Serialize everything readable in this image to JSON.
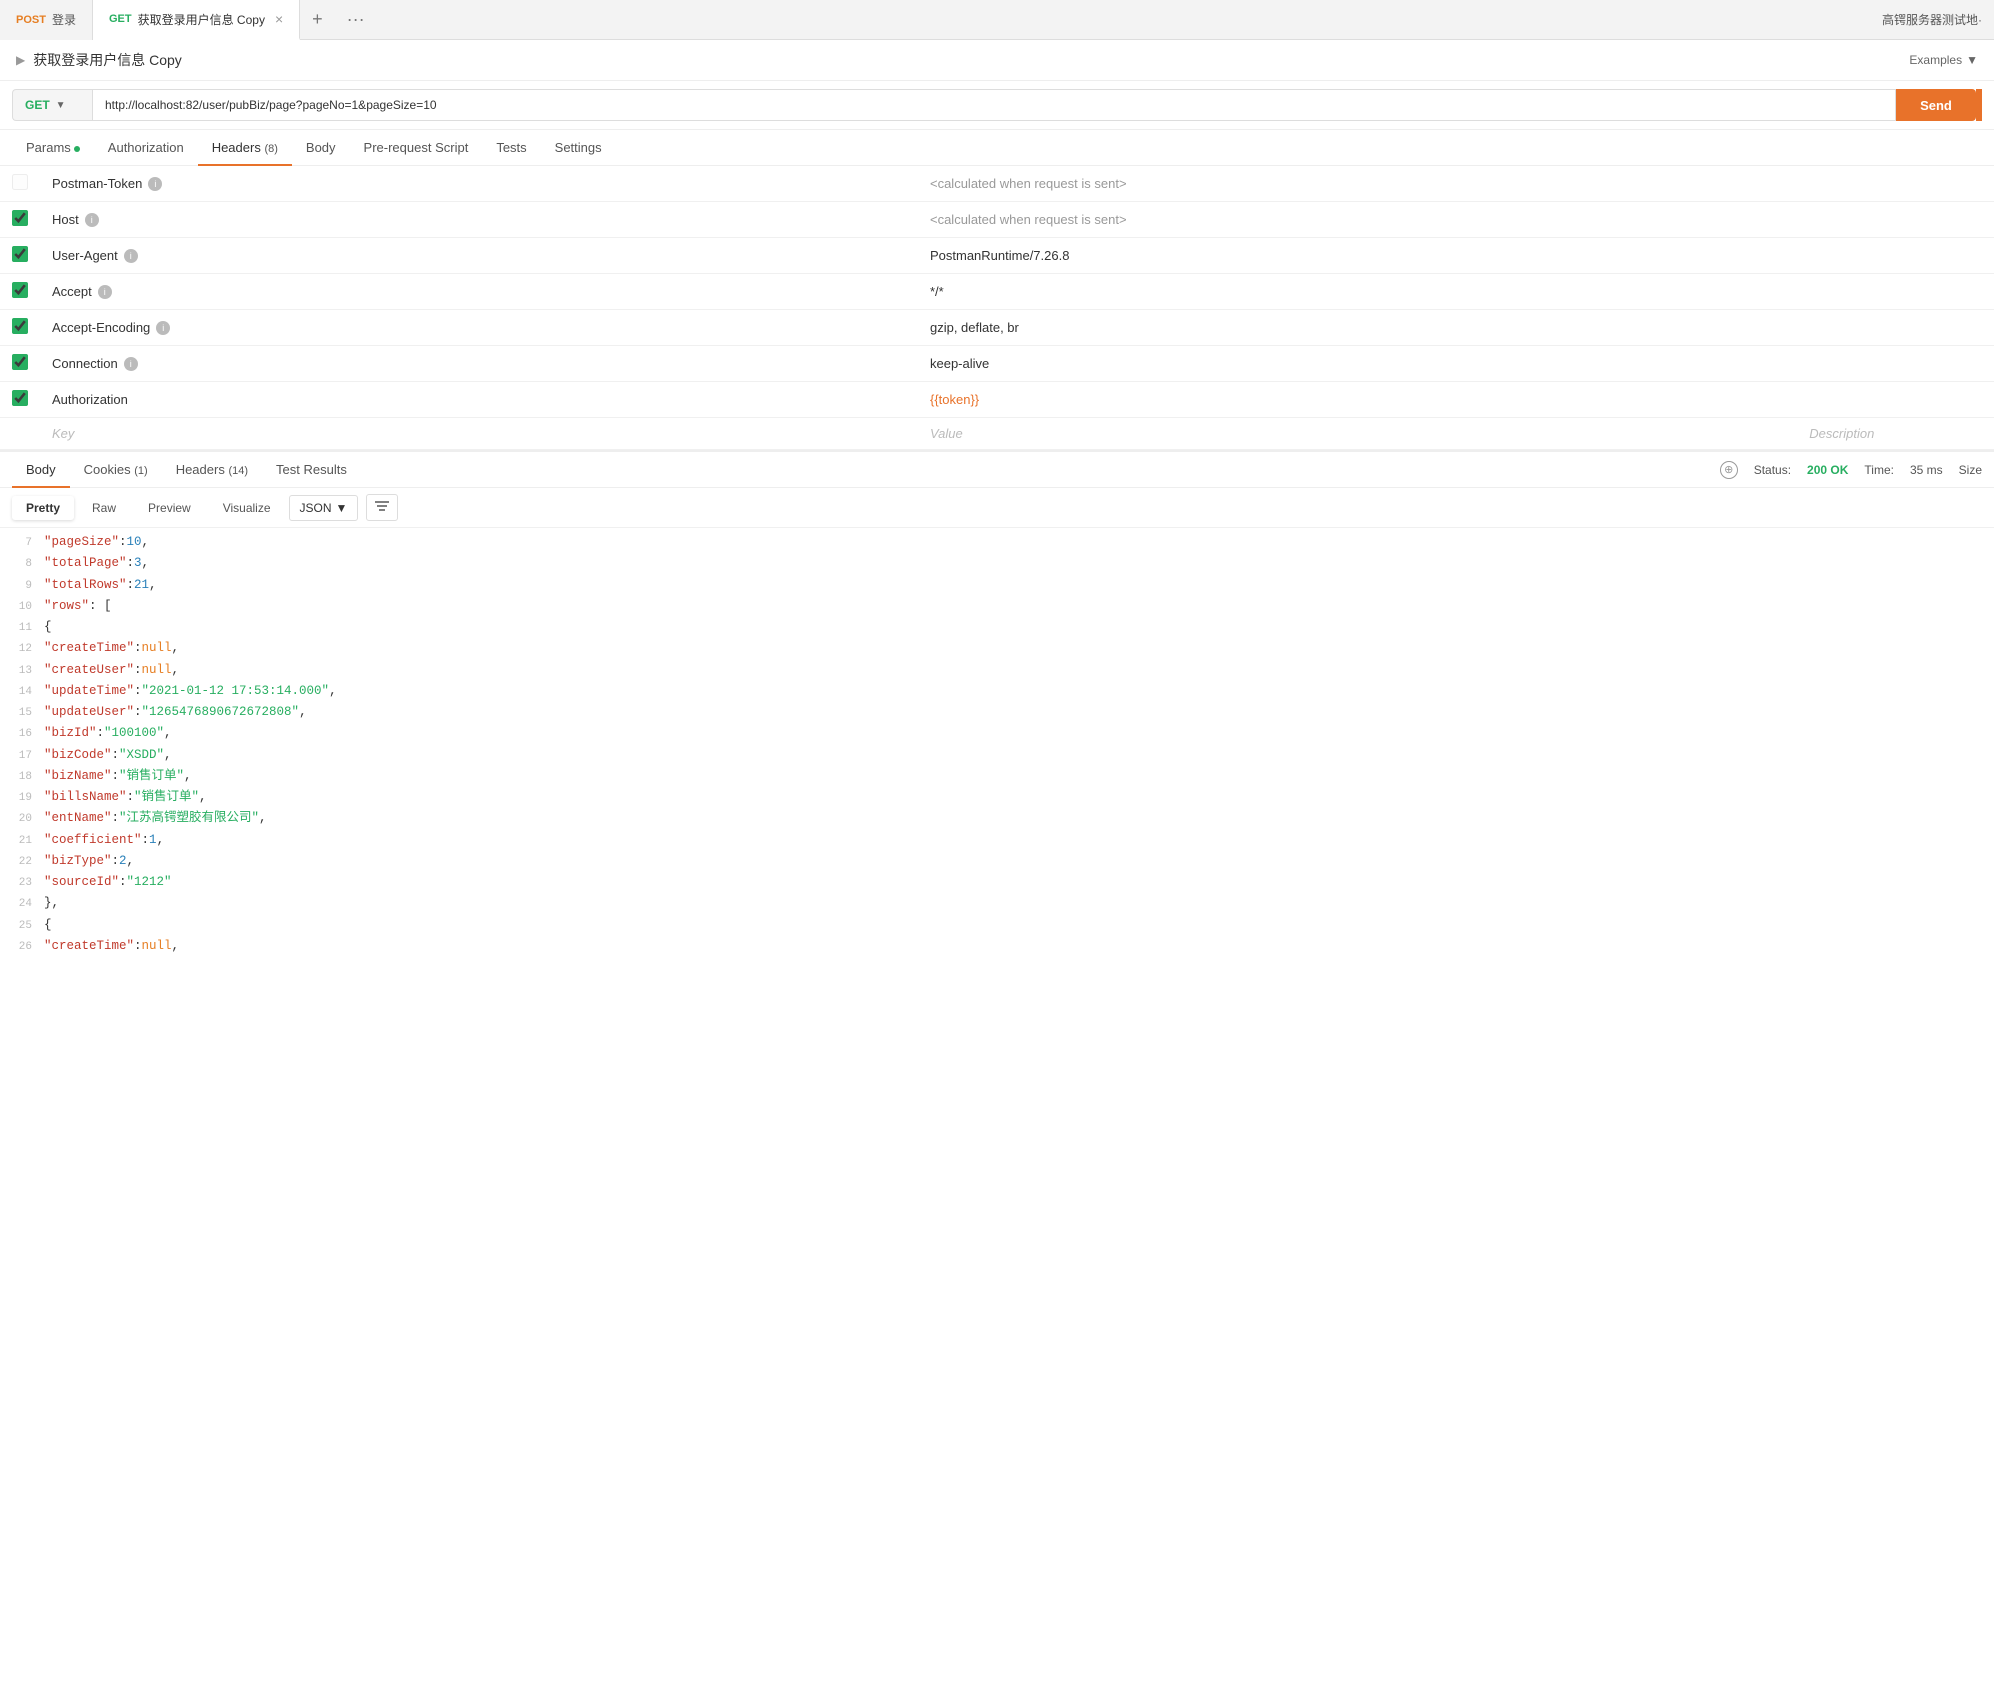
{
  "tabs": [
    {
      "id": "tab1",
      "method": "POST",
      "method_class": "post",
      "label": "登录",
      "active": false,
      "closeable": false
    },
    {
      "id": "tab2",
      "method": "GET",
      "method_class": "get",
      "label": "获取登录用户信息 Copy",
      "active": true,
      "closeable": true
    }
  ],
  "tab_add_label": "+",
  "tab_more_label": "···",
  "tab_right_label": "高锷服务器测试地·",
  "request_title": "获取登录用户信息 Copy",
  "examples_label": "Examples",
  "examples_caret": "▼",
  "url_method": "GET",
  "url_value": "http://localhost:82/user/pubBiz/page?pageNo=1&pageSize=10",
  "send_label": "Send",
  "request_tabs": [
    {
      "id": "params",
      "label": "Params",
      "has_dot": true,
      "badge": "",
      "active": false
    },
    {
      "id": "authorization",
      "label": "Authorization",
      "badge": "",
      "active": false
    },
    {
      "id": "headers",
      "label": "Headers",
      "badge": "(8)",
      "active": true
    },
    {
      "id": "body",
      "label": "Body",
      "badge": "",
      "active": false
    },
    {
      "id": "prerequest",
      "label": "Pre-request Script",
      "badge": "",
      "active": false
    },
    {
      "id": "tests",
      "label": "Tests",
      "badge": "",
      "active": false
    },
    {
      "id": "settings",
      "label": "Settings",
      "badge": "",
      "active": false
    }
  ],
  "headers": [
    {
      "checked": false,
      "disabled": true,
      "key": "Postman-Token",
      "has_info": true,
      "value": "<calculated when request is sent>",
      "value_class": "calc",
      "desc": ""
    },
    {
      "checked": true,
      "disabled": false,
      "key": "Host",
      "has_info": true,
      "value": "<calculated when request is sent>",
      "value_class": "calc",
      "desc": ""
    },
    {
      "checked": true,
      "disabled": false,
      "key": "User-Agent",
      "has_info": true,
      "value": "PostmanRuntime/7.26.8",
      "value_class": "normal",
      "desc": ""
    },
    {
      "checked": true,
      "disabled": false,
      "key": "Accept",
      "has_info": true,
      "value": "*/*",
      "value_class": "normal",
      "desc": ""
    },
    {
      "checked": true,
      "disabled": false,
      "key": "Accept-Encoding",
      "has_info": true,
      "value": "gzip, deflate, br",
      "value_class": "normal",
      "desc": ""
    },
    {
      "checked": true,
      "disabled": false,
      "key": "Connection",
      "has_info": true,
      "value": "keep-alive",
      "value_class": "normal",
      "desc": ""
    },
    {
      "checked": true,
      "disabled": false,
      "key": "Authorization",
      "has_info": false,
      "value": "{{token}}",
      "value_class": "token",
      "desc": ""
    }
  ],
  "placeholder_key": "Key",
  "placeholder_value": "Value",
  "placeholder_desc": "Description",
  "response_tabs": [
    {
      "id": "body",
      "label": "Body",
      "badge": "",
      "active": true
    },
    {
      "id": "cookies",
      "label": "Cookies",
      "badge": "(1)",
      "active": false
    },
    {
      "id": "headers",
      "label": "Headers",
      "badge": "(14)",
      "active": false
    },
    {
      "id": "test_results",
      "label": "Test Results",
      "badge": "",
      "active": false
    }
  ],
  "status_label": "Status:",
  "status_value": "200 OK",
  "time_label": "Time:",
  "time_value": "35 ms",
  "size_label": "Size",
  "format_buttons": [
    {
      "id": "pretty",
      "label": "Pretty",
      "active": true
    },
    {
      "id": "raw",
      "label": "Raw",
      "active": false
    },
    {
      "id": "preview",
      "label": "Preview",
      "active": false
    },
    {
      "id": "visualize",
      "label": "Visualize",
      "active": false
    }
  ],
  "json_format": "JSON",
  "json_lines": [
    {
      "num": 7,
      "content": [
        {
          "type": "indent",
          "v": "        "
        },
        {
          "type": "key",
          "v": "\"pageSize\""
        },
        {
          "type": "punct",
          "v": ": "
        },
        {
          "type": "number",
          "v": "10"
        },
        {
          "type": "punct",
          "v": ","
        }
      ]
    },
    {
      "num": 8,
      "content": [
        {
          "type": "indent",
          "v": "        "
        },
        {
          "type": "key",
          "v": "\"totalPage\""
        },
        {
          "type": "punct",
          "v": ": "
        },
        {
          "type": "number",
          "v": "3"
        },
        {
          "type": "punct",
          "v": ","
        }
      ]
    },
    {
      "num": 9,
      "content": [
        {
          "type": "indent",
          "v": "        "
        },
        {
          "type": "key",
          "v": "\"totalRows\""
        },
        {
          "type": "punct",
          "v": ": "
        },
        {
          "type": "number",
          "v": "21"
        },
        {
          "type": "punct",
          "v": ","
        }
      ]
    },
    {
      "num": 10,
      "content": [
        {
          "type": "indent",
          "v": "        "
        },
        {
          "type": "key",
          "v": "\"rows\""
        },
        {
          "type": "punct",
          "v": ": ["
        }
      ]
    },
    {
      "num": 11,
      "content": [
        {
          "type": "indent",
          "v": "            "
        },
        {
          "type": "punct",
          "v": "{"
        }
      ]
    },
    {
      "num": 12,
      "content": [
        {
          "type": "indent",
          "v": "                "
        },
        {
          "type": "key",
          "v": "\"createTime\""
        },
        {
          "type": "punct",
          "v": ": "
        },
        {
          "type": "null",
          "v": "null"
        },
        {
          "type": "punct",
          "v": ","
        }
      ]
    },
    {
      "num": 13,
      "content": [
        {
          "type": "indent",
          "v": "                "
        },
        {
          "type": "key",
          "v": "\"createUser\""
        },
        {
          "type": "punct",
          "v": ": "
        },
        {
          "type": "null",
          "v": "null"
        },
        {
          "type": "punct",
          "v": ","
        }
      ]
    },
    {
      "num": 14,
      "content": [
        {
          "type": "indent",
          "v": "                "
        },
        {
          "type": "key",
          "v": "\"updateTime\""
        },
        {
          "type": "punct",
          "v": ": "
        },
        {
          "type": "string",
          "v": "\"2021-01-12 17:53:14.000\""
        },
        {
          "type": "punct",
          "v": ","
        }
      ]
    },
    {
      "num": 15,
      "content": [
        {
          "type": "indent",
          "v": "                "
        },
        {
          "type": "key",
          "v": "\"updateUser\""
        },
        {
          "type": "punct",
          "v": ": "
        },
        {
          "type": "string",
          "v": "\"1265476890672672808\""
        },
        {
          "type": "punct",
          "v": ","
        }
      ]
    },
    {
      "num": 16,
      "content": [
        {
          "type": "indent",
          "v": "                "
        },
        {
          "type": "key",
          "v": "\"bizId\""
        },
        {
          "type": "punct",
          "v": ": "
        },
        {
          "type": "string",
          "v": "\"100100\""
        },
        {
          "type": "punct",
          "v": ","
        }
      ]
    },
    {
      "num": 17,
      "content": [
        {
          "type": "indent",
          "v": "                "
        },
        {
          "type": "key",
          "v": "\"bizCode\""
        },
        {
          "type": "punct",
          "v": ": "
        },
        {
          "type": "string",
          "v": "\"XSDD\""
        },
        {
          "type": "punct",
          "v": ","
        }
      ]
    },
    {
      "num": 18,
      "content": [
        {
          "type": "indent",
          "v": "                "
        },
        {
          "type": "key",
          "v": "\"bizName\""
        },
        {
          "type": "punct",
          "v": ": "
        },
        {
          "type": "string",
          "v": "\"销售订单\""
        },
        {
          "type": "punct",
          "v": ","
        }
      ]
    },
    {
      "num": 19,
      "content": [
        {
          "type": "indent",
          "v": "                "
        },
        {
          "type": "key",
          "v": "\"billsName\""
        },
        {
          "type": "punct",
          "v": ": "
        },
        {
          "type": "string",
          "v": "\"销售订单\""
        },
        {
          "type": "punct",
          "v": ","
        }
      ]
    },
    {
      "num": 20,
      "content": [
        {
          "type": "indent",
          "v": "                "
        },
        {
          "type": "key",
          "v": "\"entName\""
        },
        {
          "type": "punct",
          "v": ": "
        },
        {
          "type": "string",
          "v": "\"江苏高锷塑胶有限公司\""
        },
        {
          "type": "punct",
          "v": ","
        }
      ]
    },
    {
      "num": 21,
      "content": [
        {
          "type": "indent",
          "v": "                "
        },
        {
          "type": "key",
          "v": "\"coefficient\""
        },
        {
          "type": "punct",
          "v": ": "
        },
        {
          "type": "number",
          "v": "1"
        },
        {
          "type": "punct",
          "v": ","
        }
      ]
    },
    {
      "num": 22,
      "content": [
        {
          "type": "indent",
          "v": "                "
        },
        {
          "type": "key",
          "v": "\"bizType\""
        },
        {
          "type": "punct",
          "v": ": "
        },
        {
          "type": "number",
          "v": "2"
        },
        {
          "type": "punct",
          "v": ","
        }
      ]
    },
    {
      "num": 23,
      "content": [
        {
          "type": "indent",
          "v": "                "
        },
        {
          "type": "key",
          "v": "\"sourceId\""
        },
        {
          "type": "punct",
          "v": ": "
        },
        {
          "type": "string",
          "v": "\"1212\""
        }
      ]
    },
    {
      "num": 24,
      "content": [
        {
          "type": "indent",
          "v": "            "
        },
        {
          "type": "punct",
          "v": "},"
        }
      ]
    },
    {
      "num": 25,
      "content": [
        {
          "type": "indent",
          "v": "            "
        },
        {
          "type": "punct",
          "v": "{"
        }
      ]
    },
    {
      "num": 26,
      "content": [
        {
          "type": "indent",
          "v": "                "
        },
        {
          "type": "key",
          "v": "\"createTime\""
        },
        {
          "type": "punct",
          "v": ": "
        },
        {
          "type": "null",
          "v": "null"
        },
        {
          "type": "punct",
          "v": ","
        }
      ]
    }
  ]
}
